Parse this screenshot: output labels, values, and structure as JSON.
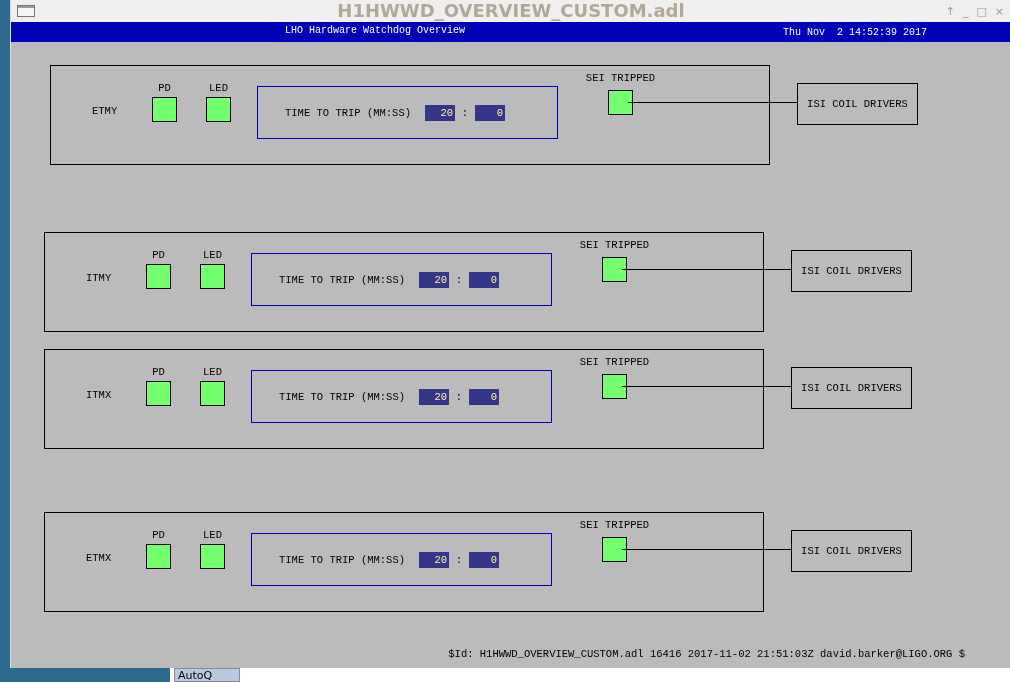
{
  "window": {
    "title": "H1HWWD_OVERVIEW_CUSTOM.adl",
    "controls": [
      "↑",
      "_",
      "□",
      "×"
    ]
  },
  "header": {
    "title": "LHO Hardware Watchdog Overview",
    "datetime": "Thu Nov  2 14:52:39 2017"
  },
  "panels": [
    {
      "name": "ETMY",
      "pd": {
        "label": "PD",
        "color": "#73ff6e"
      },
      "led": {
        "label": "LED",
        "color": "#73ff6e"
      },
      "time_label": "TIME TO TRIP (MM:SS)",
      "minutes": "20",
      "separator": ":",
      "seconds": "0",
      "sei": {
        "label": "SEI TRIPPED",
        "color": "#73ff6e"
      },
      "coil": "ISI COIL DRIVERS"
    },
    {
      "name": "ITMY",
      "pd": {
        "label": "PD",
        "color": "#73ff6e"
      },
      "led": {
        "label": "LED",
        "color": "#73ff6e"
      },
      "time_label": "TIME TO TRIP (MM:SS)",
      "minutes": "20",
      "separator": ":",
      "seconds": "0",
      "sei": {
        "label": "SEI TRIPPED",
        "color": "#73ff6e"
      },
      "coil": "ISI COIL DRIVERS"
    },
    {
      "name": "ITMX",
      "pd": {
        "label": "PD",
        "color": "#73ff6e"
      },
      "led": {
        "label": "LED",
        "color": "#73ff6e"
      },
      "time_label": "TIME TO TRIP (MM:SS)",
      "minutes": "20",
      "separator": ":",
      "seconds": "0",
      "sei": {
        "label": "SEI TRIPPED",
        "color": "#73ff6e"
      },
      "coil": "ISI COIL DRIVERS"
    },
    {
      "name": "ETMX",
      "pd": {
        "label": "PD",
        "color": "#73ff6e"
      },
      "led": {
        "label": "LED",
        "color": "#73ff6e"
      },
      "time_label": "TIME TO TRIP (MM:SS)",
      "minutes": "20",
      "separator": ":",
      "seconds": "0",
      "sei": {
        "label": "SEI TRIPPED",
        "color": "#73ff6e"
      },
      "coil": "ISI COIL DRIVERS"
    }
  ],
  "footer": "$Id: H1HWWD_OVERVIEW_CUSTOM.adl 16416 2017-11-02 21:51:03Z david.barker@LIGO.ORG $",
  "taskbar": [
    {
      "label": "AutoQ"
    }
  ]
}
